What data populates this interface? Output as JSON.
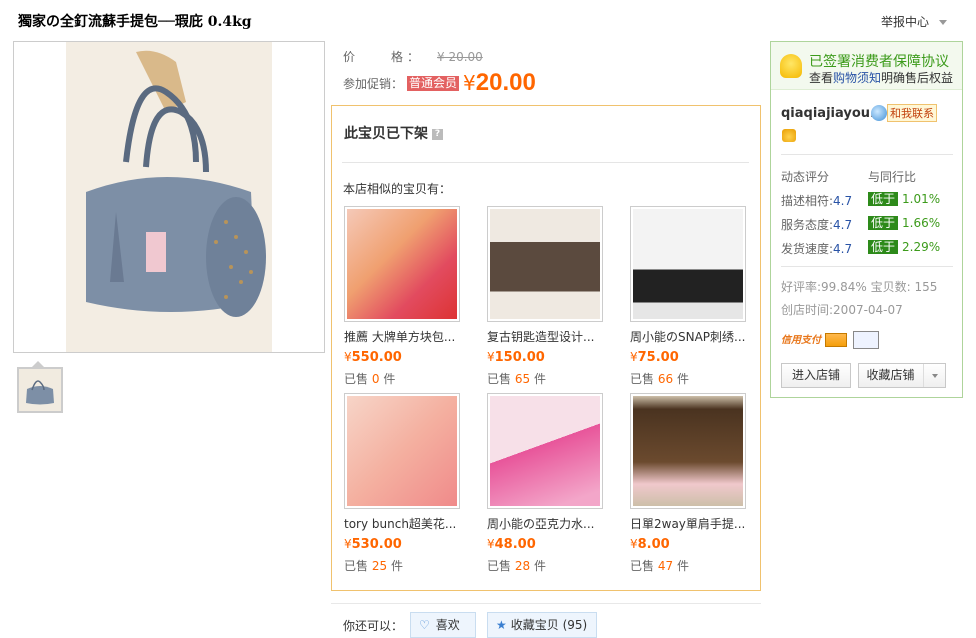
{
  "product": {
    "title": "獨家の全釘流蘇手提包──瑕庇 0.4kg",
    "price_label": "价　　格：",
    "price": "¥ 20.00",
    "promo_label": "参加促销：",
    "member_badge": "普通会员",
    "promo_currency": "¥",
    "promo_price": "20.00"
  },
  "header": {
    "report": "举报中心"
  },
  "offshelf": {
    "title": "此宝贝已下架",
    "help": "?",
    "similar_label": "本店相似的宝贝有："
  },
  "items": [
    {
      "name": "推薦 大牌单方块包...",
      "currency": "¥",
      "price": "550.00",
      "sold_prefix": "已售",
      "sold": "0",
      "sold_unit": "件",
      "colors": [
        "#f5c9b8",
        "#e24b5f"
      ]
    },
    {
      "name": "复古钥匙造型设计...",
      "currency": "¥",
      "price": "150.00",
      "sold_prefix": "已售",
      "sold": "65",
      "sold_unit": "件",
      "colors": [
        "#e9e4dc",
        "#5b4a3e"
      ]
    },
    {
      "name": "周小能のSNAP刺绣...",
      "currency": "¥",
      "price": "75.00",
      "sold_prefix": "已售",
      "sold": "66",
      "sold_unit": "件",
      "colors": [
        "#f3f3f3",
        "#222222"
      ]
    },
    {
      "name": "tory bunch超美花...",
      "currency": "¥",
      "price": "530.00",
      "sold_prefix": "已售",
      "sold": "25",
      "sold_unit": "件",
      "colors": [
        "#f7d5c8",
        "#f08a8a"
      ]
    },
    {
      "name": "周小能の亞克力水...",
      "currency": "¥",
      "price": "48.00",
      "sold_prefix": "已售",
      "sold": "28",
      "sold_unit": "件",
      "colors": [
        "#f7e0e8",
        "#e8559a"
      ]
    },
    {
      "name": "日單2way單肩手提...",
      "currency": "¥",
      "price": "8.00",
      "sold_prefix": "已售",
      "sold": "47",
      "sold_unit": "件",
      "colors": [
        "#cdbfa9",
        "#4a3320"
      ]
    }
  ],
  "actions": {
    "label": "你还可以：",
    "like": "喜欢",
    "favorite": "收藏宝贝 (95)"
  },
  "seller": {
    "guarantee_title": "已签署消费者保障协议",
    "guarantee_pre": "查看",
    "guarantee_link": "购物须知",
    "guarantee_post": "明确售后权益",
    "name": "qiaqiajiayou...",
    "contact": "和我联系",
    "rating_header": "动态评分",
    "compare_header": "与同行比",
    "ratings": [
      {
        "label": "描述相符:",
        "score": "4.7",
        "tag": "低于",
        "pct": "1.01%"
      },
      {
        "label": "服务态度:",
        "score": "4.7",
        "tag": "低于",
        "pct": "1.66%"
      },
      {
        "label": "发货速度:",
        "score": "4.7",
        "tag": "低于",
        "pct": "2.29%"
      }
    ],
    "stats": "好评率:99.84%  宝贝数: 155",
    "since": "创店时间:2007-04-07",
    "credit_card": "信用支付",
    "enter_shop": "进入店铺",
    "fav_shop": "收藏店铺"
  }
}
